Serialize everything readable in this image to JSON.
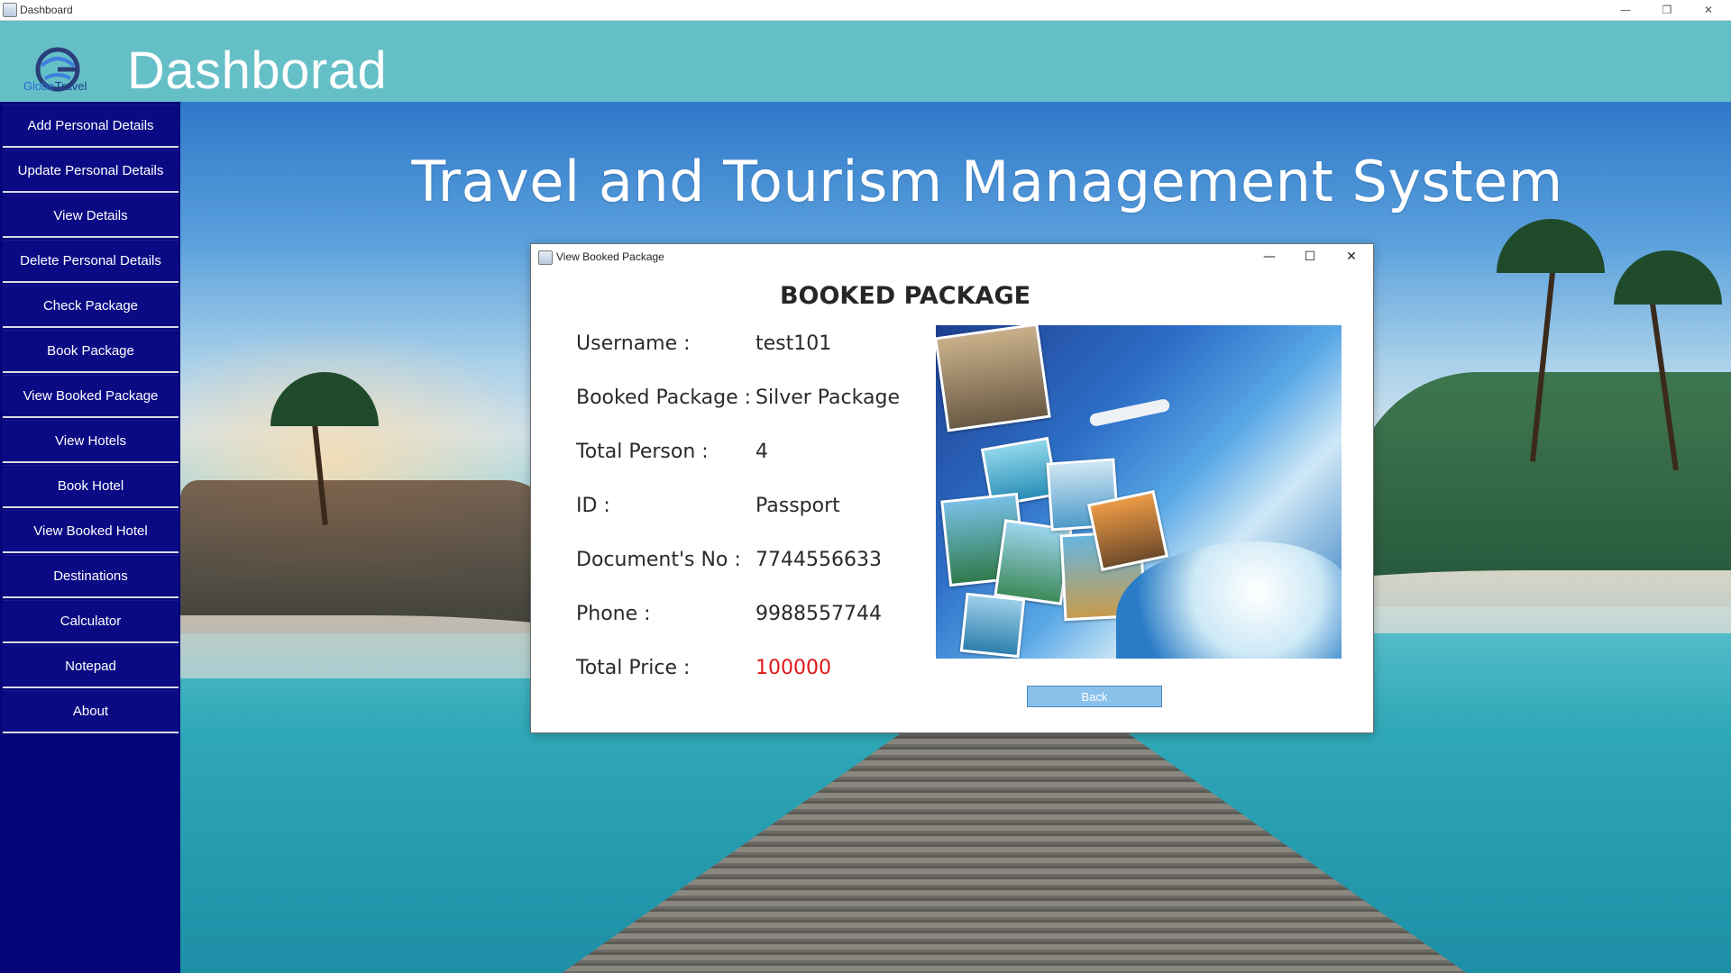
{
  "window": {
    "title": "Dashboard",
    "controls": {
      "minimize": "—",
      "restore": "❐",
      "close": "✕"
    }
  },
  "header": {
    "logo_text_a": "Globe",
    "logo_text_b": "Travel",
    "title": "Dashborad"
  },
  "sidebar": {
    "items": [
      {
        "label": "Add Personal Details"
      },
      {
        "label": "Update Personal Details"
      },
      {
        "label": "View Details"
      },
      {
        "label": "Delete Personal Details"
      },
      {
        "label": "Check Package"
      },
      {
        "label": "Book Package"
      },
      {
        "label": "View Booked Package"
      },
      {
        "label": "View Hotels"
      },
      {
        "label": "Book Hotel"
      },
      {
        "label": "View Booked Hotel"
      },
      {
        "label": "Destinations"
      },
      {
        "label": "Calculator"
      },
      {
        "label": "Notepad"
      },
      {
        "label": "About"
      }
    ]
  },
  "main": {
    "banner_title": "Travel and Tourism Management System"
  },
  "dialog": {
    "title": "View Booked Package",
    "controls": {
      "minimize": "—",
      "maximize": "☐",
      "close": "✕"
    },
    "heading": "BOOKED PACKAGE",
    "rows": [
      {
        "label": "Username  :",
        "value": "test101"
      },
      {
        "label": "Booked Package  :",
        "value": "Silver Package"
      },
      {
        "label": "Total Person  :",
        "value": "4"
      },
      {
        "label": "ID  :",
        "value": "Passport"
      },
      {
        "label": "Document's No  :",
        "value": "7744556633"
      },
      {
        "label": "Phone  :",
        "value": "9988557744"
      },
      {
        "label": "Total Price  :",
        "value": "100000"
      }
    ],
    "back_label": "Back"
  },
  "colors": {
    "header": "#65bfc7",
    "sidebar": "#05057a",
    "price": "#e01818",
    "back_button": "#89c1ea"
  }
}
